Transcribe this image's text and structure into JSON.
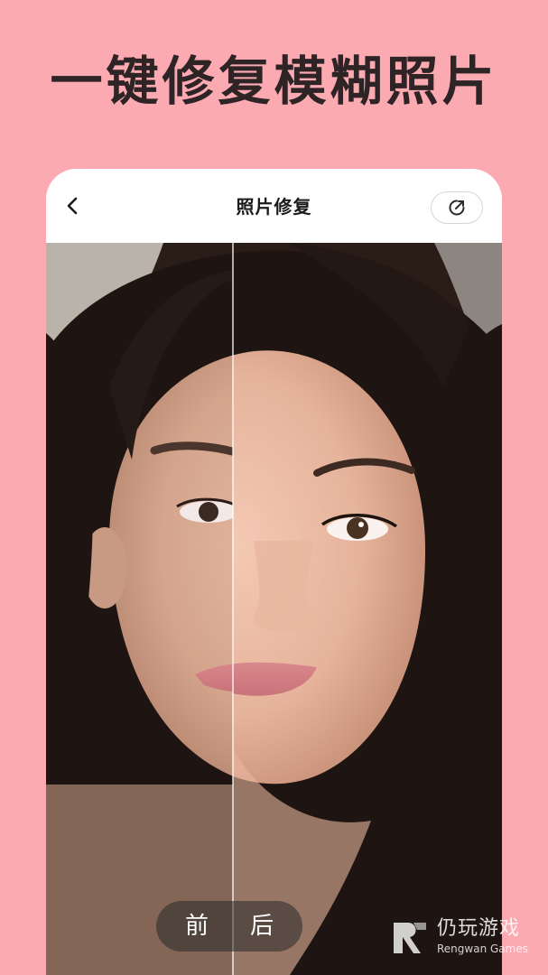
{
  "headline": "一键修复模糊照片",
  "navbar": {
    "title": "照片修复",
    "back_icon": "chevron-left-icon",
    "share_icon": "share-arrow-icon"
  },
  "compare": {
    "before_label": "前",
    "after_label": "后"
  },
  "watermark": {
    "name_cn": "仍玩游戏",
    "name_en": "Rengwan Games"
  },
  "colors": {
    "background": "#fbaab2",
    "headline_text": "#2e2325",
    "card": "#ffffff"
  }
}
